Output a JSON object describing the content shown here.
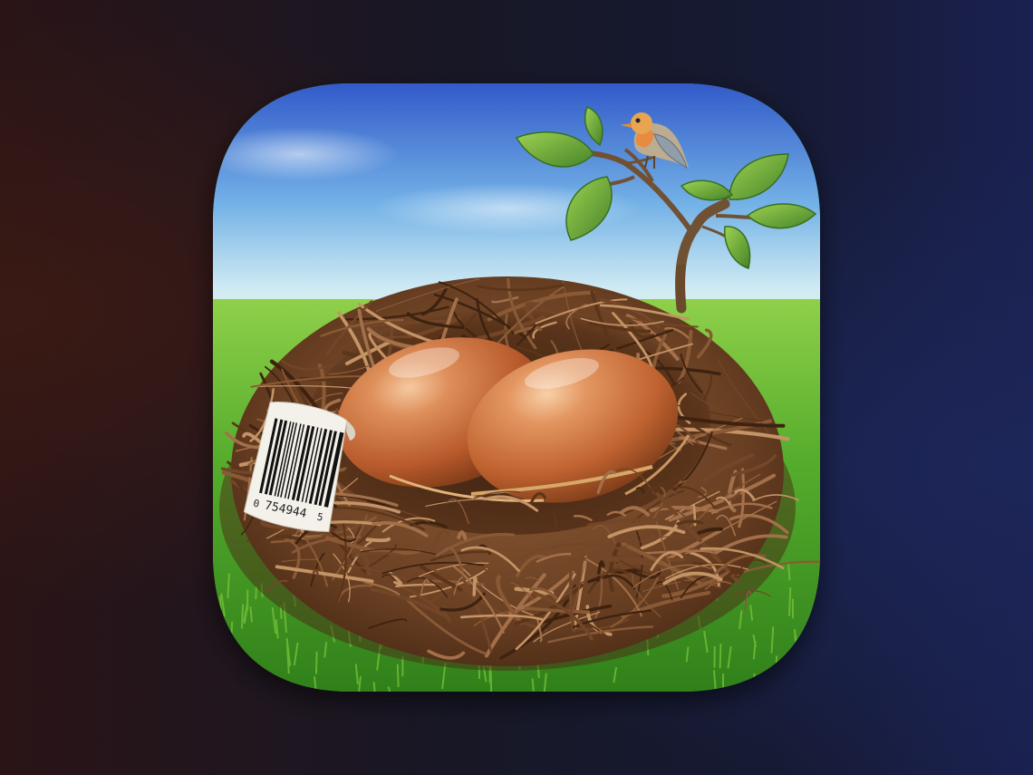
{
  "app_icon": {
    "subject": "bird-nest-with-eggs",
    "barcode_tag": {
      "leading_digit": "0",
      "number": "754944",
      "trailing_digit": "5"
    }
  },
  "colors": {
    "sky_top": "#2f5fd0",
    "sky_bottom": "#bfe3f4",
    "grass": "#4fa82a",
    "egg": "#c8693a",
    "nest": "#6b4226",
    "leaf": "#5a9a2a",
    "bird_breast": "#e88a3a"
  }
}
